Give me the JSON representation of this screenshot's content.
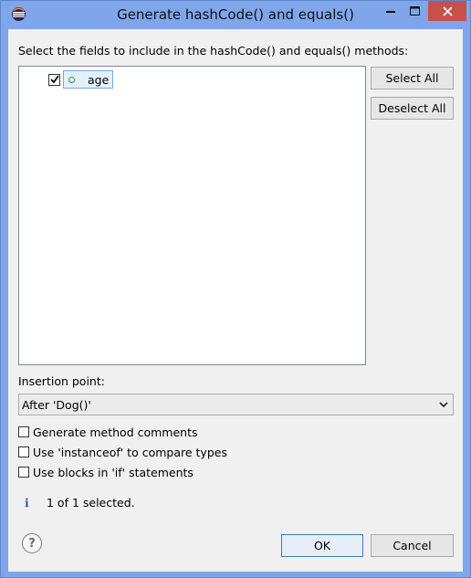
{
  "window": {
    "title": "Generate hashCode() and equals()",
    "icon": "eclipse-icon"
  },
  "instruction": "Select the fields to include in the hashCode() and equals() methods:",
  "fields": [
    {
      "name": "age",
      "checked": true,
      "icon": "field-icon"
    }
  ],
  "buttons": {
    "select_all": "Select All",
    "deselect_all": "Deselect All",
    "ok": "OK",
    "cancel": "Cancel",
    "help": "?"
  },
  "insertion_point": {
    "label": "Insertion point:",
    "selected": "After 'Dog()'"
  },
  "options": [
    {
      "label": "Generate method comments",
      "checked": false
    },
    {
      "label": "Use 'instanceof' to compare types",
      "checked": false
    },
    {
      "label": "Use blocks in 'if' statements",
      "checked": false
    }
  ],
  "status": {
    "icon": "info-icon",
    "glyph": "i",
    "text": "1 of 1 selected."
  },
  "colors": {
    "titlebar": "#7fa6ea",
    "close_button": "#c7504a",
    "dialog_bg": "#f0f0f0",
    "selection_border": "#7aa7d9"
  }
}
